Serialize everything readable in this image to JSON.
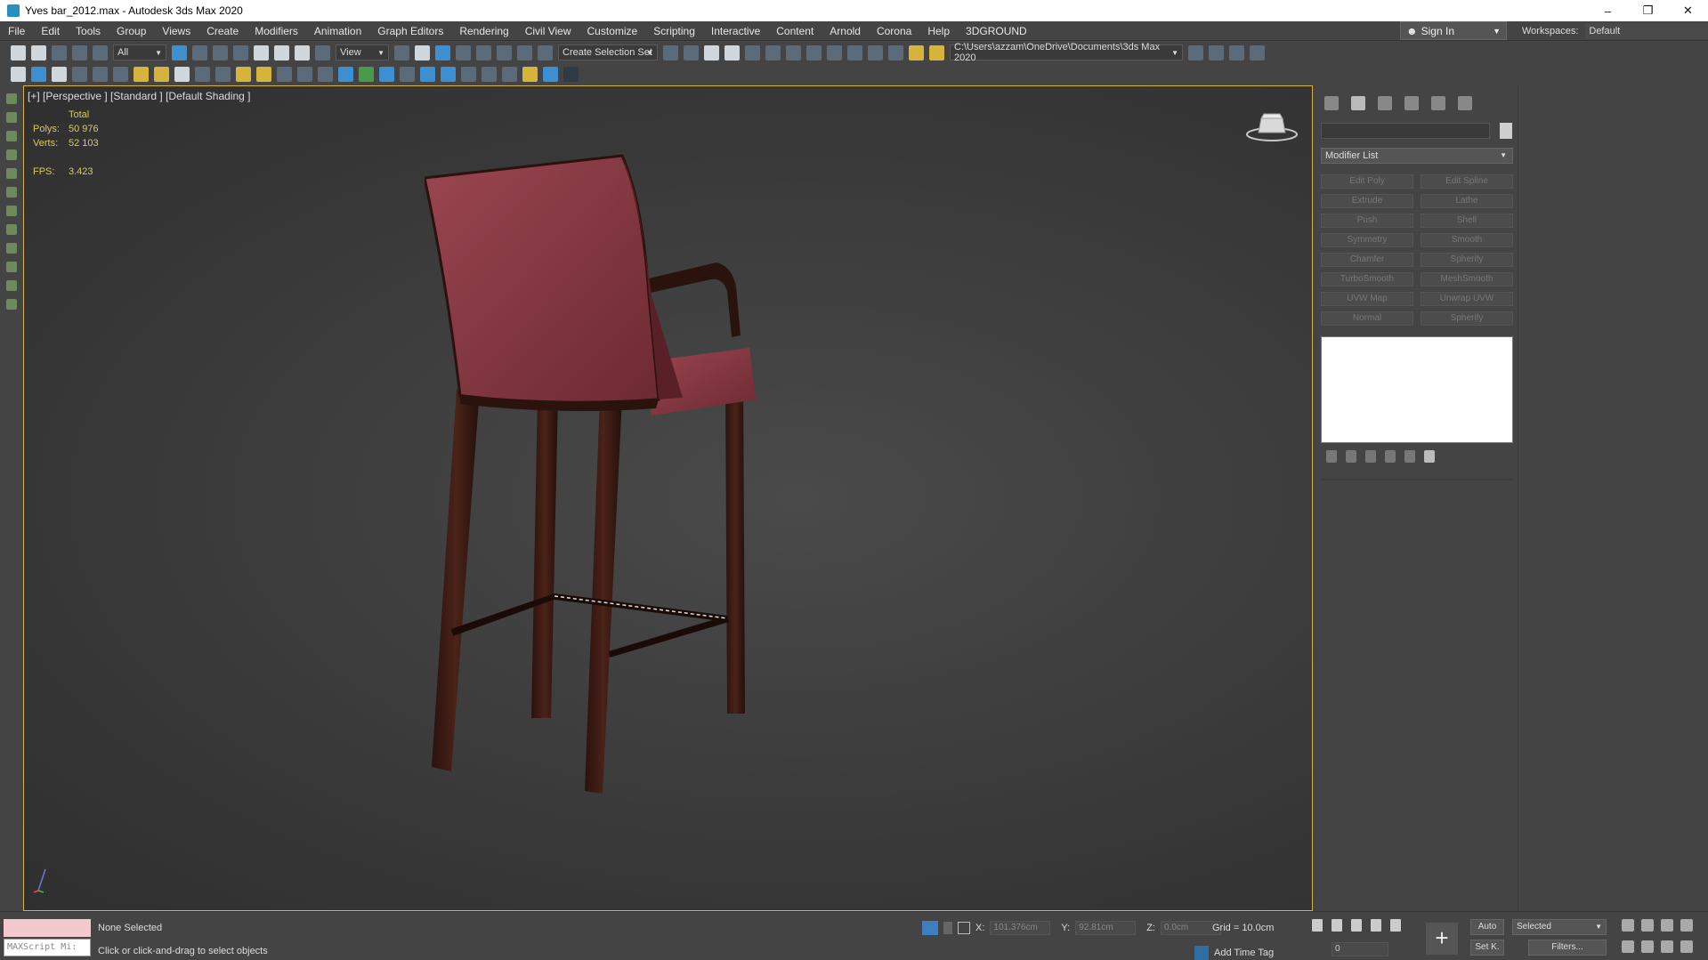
{
  "window": {
    "title": "Yves bar_2012.max - Autodesk 3ds Max 2020",
    "min": "–",
    "max": "❐",
    "close": "✕"
  },
  "menu": [
    "File",
    "Edit",
    "Tools",
    "Group",
    "Views",
    "Create",
    "Modifiers",
    "Animation",
    "Graph Editors",
    "Rendering",
    "Civil View",
    "Customize",
    "Scripting",
    "Interactive",
    "Content",
    "Arnold",
    "Corona",
    "Help",
    "3DGROUND"
  ],
  "account": {
    "signin": "Sign In",
    "workspaces_label": "Workspaces:",
    "workspace_value": "Default"
  },
  "toolbar": {
    "selection_filter": "All",
    "ref_coord": "View",
    "selection_set": "Create Selection Set",
    "project_path": "C:\\Users\\azzam\\OneDrive\\Documents\\3ds Max 2020"
  },
  "viewport": {
    "label": "[+] [Perspective ] [Standard ] [Default Shading ]",
    "stats": {
      "total_label": "Total",
      "polys_label": "Polys:",
      "polys": "50 976",
      "verts_label": "Verts:",
      "verts": "52 103",
      "fps_label": "FPS:",
      "fps": "3.423"
    },
    "colors": {
      "chair_fabric": "#8a3a42",
      "chair_wood": "#3a1b14",
      "border": "#d6b24b"
    }
  },
  "command_panel": {
    "modifier_list": "Modifier List",
    "modifiers": [
      "Edit Poly",
      "Edit Spline",
      "Extrude",
      "Lathe",
      "Push",
      "Shell",
      "Symmetry",
      "Smooth",
      "Chamfer",
      "Spherify",
      "TurboSmooth",
      "MeshSmooth",
      "UVW Map",
      "Unwrap UVW",
      "Normal",
      "Spherify"
    ]
  },
  "status": {
    "maxscript": "MAXScript Mi:",
    "selection": "None Selected",
    "prompt": "Click or click-and-drag to select objects",
    "x_label": "X:",
    "x": "101.376cm",
    "y_label": "Y:",
    "y": "92.81cm",
    "z_label": "Z:",
    "z": "0.0cm",
    "grid": "Grid = 10.0cm",
    "add_time_tag": "Add Time Tag",
    "frame": "0",
    "auto": "Auto",
    "setk": "Set K.",
    "selected": "Selected",
    "filters": "Filters..."
  }
}
